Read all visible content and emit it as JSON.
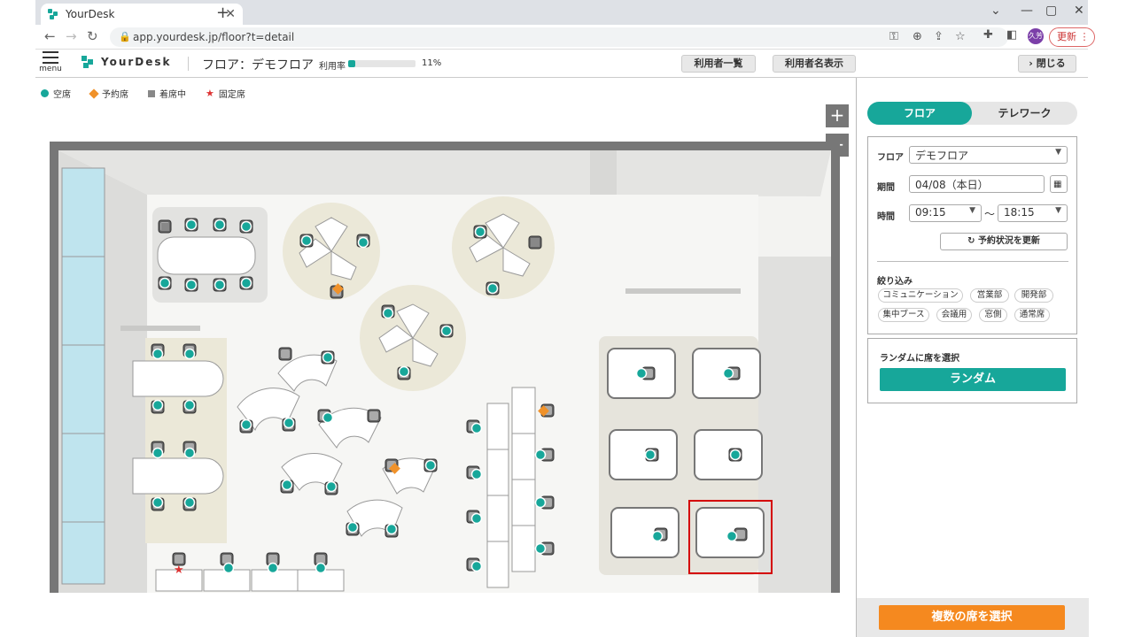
{
  "browser": {
    "tab_title": "YourDesk",
    "url": "app.yourdesk.jp/floor?t=detail",
    "profile_initials": "久芳",
    "update_label": "更新"
  },
  "header": {
    "menu_label": "menu",
    "logo_text": "YourDesk",
    "floor_title": "フロア：デモフロア",
    "usage_label": "利用率",
    "usage_value": 0.11,
    "usage_text": "11%",
    "user_list_label": "利用者一覧",
    "show_names_label": "利用者名表示",
    "close_label": "閉じる"
  },
  "legend": {
    "vacant": "空席",
    "reserved": "予約席",
    "occupied": "着席中",
    "fixed": "固定席"
  },
  "zoom": {
    "in": "+",
    "out": "−"
  },
  "panel": {
    "tab_floor": "フロア",
    "tab_telework": "テレワーク",
    "floor_label": "フロア",
    "floor_value": "デモフロア",
    "period_label": "期間",
    "period_value": "04/08（本日）",
    "time_label": "時間",
    "time_from": "09:15",
    "time_sep": "〜",
    "time_to": "18:15",
    "refresh_label": "予約状況を更新",
    "filter_label": "絞り込み",
    "filters": [
      "コミュニケーション",
      "営業部",
      "開発部",
      "集中ブース",
      "会議用",
      "窓側",
      "通常席"
    ],
    "random_title": "ランダムに席を選択",
    "random_button": "ランダム",
    "multi_button": "複数の席を選択"
  },
  "colors": {
    "accent": "#17a79a",
    "reserved": "#f0922a",
    "occupied": "#888888",
    "fixed": "#dd3333",
    "multi": "#f5891f"
  }
}
